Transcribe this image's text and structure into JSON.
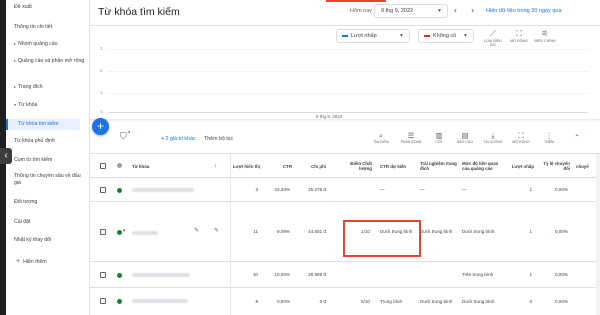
{
  "sidebar": {
    "items": [
      {
        "label": "Đề xuất",
        "expandable": false
      },
      {
        "label": "Thông tin chi tiết",
        "expandable": false
      },
      {
        "label": "Nhóm quảng cáo",
        "expandable": true
      },
      {
        "label": "Quảng cáo và phần mở rộng",
        "expandable": true
      },
      {
        "label": "Trang đích",
        "expandable": true
      },
      {
        "label": "Từ khóa",
        "expandable": true
      },
      {
        "label": "Từ khóa tìm kiếm",
        "expandable": false,
        "active": true
      },
      {
        "label": "Từ khóa phủ định",
        "expandable": false
      },
      {
        "label": "Cụm từ tìm kiếm",
        "expandable": false
      },
      {
        "label": "Thông tin chuyên sâu về đấu giá",
        "expandable": false
      },
      {
        "label": "Đối tượng",
        "expandable": false
      },
      {
        "label": "Cài đặt",
        "expandable": false
      },
      {
        "label": "Nhật ký thay đổi",
        "expandable": false
      }
    ],
    "add_label": "Hiển thêm"
  },
  "header": {
    "title": "Từ khóa tìm kiếm",
    "today_label": "Hôm nay",
    "date_value": "9 thg 9, 2022",
    "last30_link": "Hiện dữ liệu trong 30 ngày qua"
  },
  "chart": {
    "metric1": "Lượt nhấp",
    "metric2": "Không có",
    "metric1_color": "#1a73e8",
    "metric2_color": "#d93025",
    "x_label": "9 thg 9, 2022",
    "y_ticks": [
      "3",
      "2",
      "1",
      "0"
    ],
    "tools": [
      {
        "icon": "line-chart-icon",
        "glyph": "⟋",
        "label": "LOẠI BIỂU ĐỒ"
      },
      {
        "icon": "expand-icon",
        "glyph": "⛶",
        "label": "MỞ RỘNG"
      },
      {
        "icon": "adjust-icon",
        "glyph": "⚟",
        "label": "ĐIỀU CHỈNH"
      }
    ]
  },
  "toolbar": {
    "hidden_link": "+ 2 giá trị khác",
    "add_filter": "Thêm bộ lọc",
    "tools": [
      {
        "icon": "search-icon",
        "glyph": "⌕",
        "label": "TÌM KIẾM"
      },
      {
        "icon": "segment-icon",
        "glyph": "☰",
        "label": "PHÂN ĐOẠN"
      },
      {
        "icon": "columns-icon",
        "glyph": "▥",
        "label": "CỘT"
      },
      {
        "icon": "reports-icon",
        "glyph": "▤",
        "label": "BÁO CÁO"
      },
      {
        "icon": "download-icon",
        "glyph": "⤓",
        "label": "TẢI XUỐNG"
      },
      {
        "icon": "expand-table-icon",
        "glyph": "⛶",
        "label": "MỞ RỘNG"
      },
      {
        "icon": "more-icon",
        "glyph": "⋮",
        "label": "THÊM"
      }
    ]
  },
  "table": {
    "headers": {
      "keyword": "Từ khóa",
      "impressions": "Lượt hiển thị",
      "ctr": "CTR",
      "cost": "Chi phí",
      "quality_score": "Điểm Chất lượng",
      "exp_ctr": "CTR dự kiến",
      "landing_exp": "Trải nghiệm trang đích",
      "ad_relevance": "Mức độ liên quan của quảng cáo",
      "clicks": "Lượt nhấp",
      "conv_rate": "Tỷ lệ chuyển đổi",
      "conv": "chuyể"
    },
    "rows": [
      {
        "impressions": "3",
        "ctr": "33,33%",
        "cost": "25.276 đ",
        "quality_score": "",
        "exp_ctr": "—",
        "landing_exp": "—",
        "ad_relevance": "—",
        "clicks": "1",
        "conv_rate": "0,00%"
      },
      {
        "impressions": "11",
        "ctr": "9,09%",
        "cost": "44.601 đ",
        "quality_score": "1/10",
        "exp_ctr": "Dưới trung bình",
        "landing_exp": "Dưới trung bình",
        "ad_relevance": "Dưới trung bình",
        "clicks": "1",
        "conv_rate": "0,00%"
      },
      {
        "impressions": "10",
        "ctr": "10,00%",
        "cost": "26.989 đ",
        "quality_score": "",
        "exp_ctr": "",
        "landing_exp": "",
        "ad_relevance": "Trên trung bình",
        "clicks": "1",
        "conv_rate": "0,00%"
      },
      {
        "impressions": "8",
        "ctr": "0,00%",
        "cost": "0 đ",
        "quality_score": "5/10",
        "exp_ctr": "Trung bình",
        "landing_exp": "Dưới trung bình",
        "ad_relevance": "Dưới trung bình",
        "clicks": "0",
        "conv_rate": "0,00%"
      }
    ]
  }
}
